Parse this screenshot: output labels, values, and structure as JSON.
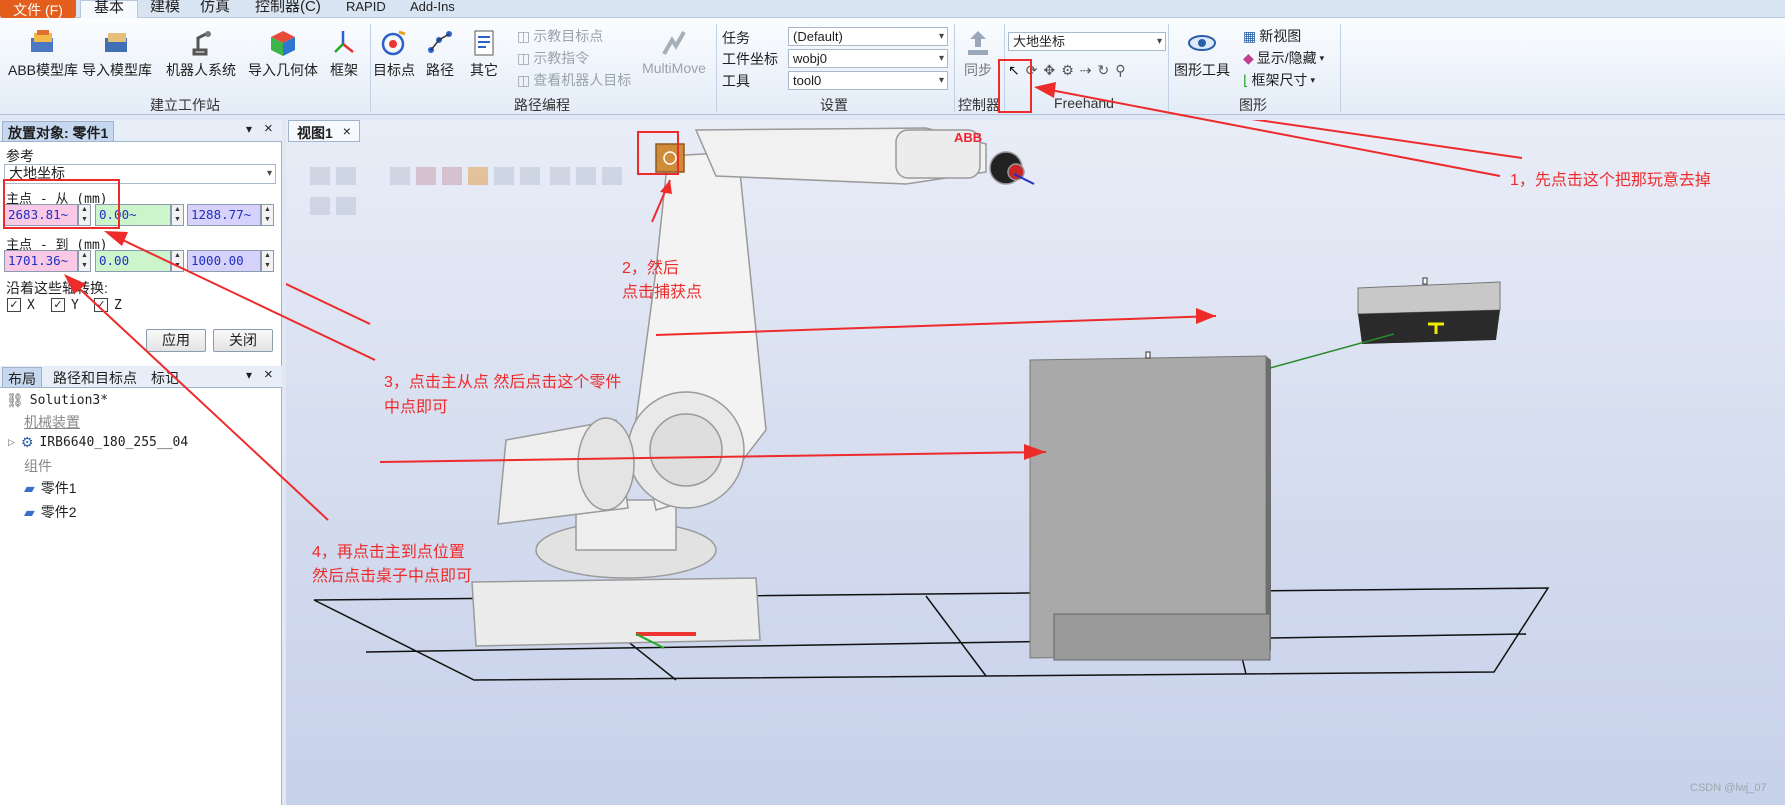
{
  "tabs": {
    "file": "文件 (F)",
    "basic": "基本",
    "modeling": "建模",
    "simulation": "仿真",
    "controller": "控制器(C)",
    "rapid": "RAPID",
    "addins": "Add-Ins"
  },
  "ribbon": {
    "build_station": {
      "abb_library": "ABB模型库",
      "import_library": "导入模型库",
      "robot_system": "机器人系统",
      "import_geometry": "导入几何体",
      "frame": "框架",
      "group_label": "建立工作站"
    },
    "path_programming": {
      "target": "目标点",
      "path": "路径",
      "other": "其它",
      "teach_target": "示教目标点",
      "teach_instruction": "示教指令",
      "view_robot_target": "查看机器人目标",
      "multimove": "MultiMove",
      "group_label": "路径编程"
    },
    "settings": {
      "task_label": "任务",
      "task_value": "(Default)",
      "wobj_label": "工件坐标",
      "wobj_value": "wobj0",
      "tool_label": "工具",
      "tool_value": "tool0",
      "group_label": "设置"
    },
    "controller": {
      "sync": "同步",
      "group_label": "控制器"
    },
    "freehand": {
      "coord_value": "大地坐标",
      "group_label": "Freehand"
    },
    "graphics": {
      "graphics_tools": "图形工具",
      "new_view": "新视图",
      "show_hide": "显示/隐藏",
      "frame_size": "框架尺寸",
      "group_label": "图形"
    }
  },
  "place_panel": {
    "title": "放置对象: 零件1",
    "reference_label": "参考",
    "reference_value": "大地坐标",
    "from_label": "主点 - 从 (mm)",
    "from_x": "2683.81~",
    "from_y": "0.00~",
    "from_z": "1288.77~",
    "to_label": "主点 - 到 (mm)",
    "to_x": "1701.36~",
    "to_y": "0.00",
    "to_z": "1000.00",
    "axis_label": "沿着这些轴转换:",
    "x": "X",
    "y": "Y",
    "z": "Z",
    "apply": "应用",
    "close": "关闭"
  },
  "layout_panel": {
    "tab_layout": "布局",
    "tab_paths": "路径和目标点",
    "tab_tags": "标记",
    "solution": "Solution3*",
    "mechanisms": "机械装置",
    "robot": "IRB6640_180_255__04",
    "components": "组件",
    "part1": "零件1",
    "part2": "零件2"
  },
  "view": {
    "tab": "视图1",
    "abb_logo": "ABB"
  },
  "annotations": {
    "a1": "1，先点击这个把那玩意去掉",
    "a2_line1": "2，然后",
    "a2_line2": "点击捕获点",
    "a3_line1": "3，点击主从点 然后点击这个零件",
    "a3_line2": "中点即可",
    "a4_line1": "4，再点击主到点位置",
    "a4_line2": "然后点击桌子中点即可"
  },
  "watermark": "CSDN @lwj_07",
  "colors": {
    "accent_red": "#ee2b2b",
    "file_tab": "#e35d1c",
    "from_x_field": "#f9c9e6",
    "y_field": "#ccf5cc",
    "z_field": "#d7d2fb"
  }
}
